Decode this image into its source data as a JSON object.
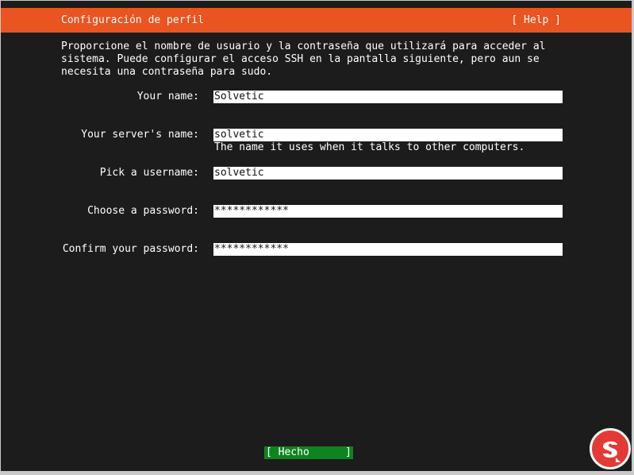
{
  "header": {
    "title": "Configuración de perfil",
    "help_label": "[ Help ]"
  },
  "intro": {
    "lines": [
      "Proporcione el nombre de usuario y la contraseña que utilizará para acceder al",
      "sistema. Puede configurar el acceso SSH en la pantalla siguiente, pero aun se",
      "necesita una contraseña para sudo."
    ]
  },
  "form": {
    "your_name": {
      "label": "Your name:",
      "value": "Solvetic"
    },
    "server_name": {
      "label": "Your server's name:",
      "value": "solvetic",
      "help": "The name it uses when it talks to other computers."
    },
    "username": {
      "label": "Pick a username:",
      "value": "solvetic"
    },
    "password": {
      "label": "Choose a password:",
      "value": "************"
    },
    "confirm_password": {
      "label": "Confirm your password:",
      "value": "************"
    }
  },
  "footer": {
    "done_button": {
      "left": "[ Hecho",
      "right": "]"
    }
  },
  "colors": {
    "header_bg": "#e95420",
    "terminal_bg": "#1c1c1c",
    "done_bg": "#0e8420",
    "logo_bg": "#e53935"
  },
  "logo": {
    "icon": "solvetic-logo-icon"
  }
}
